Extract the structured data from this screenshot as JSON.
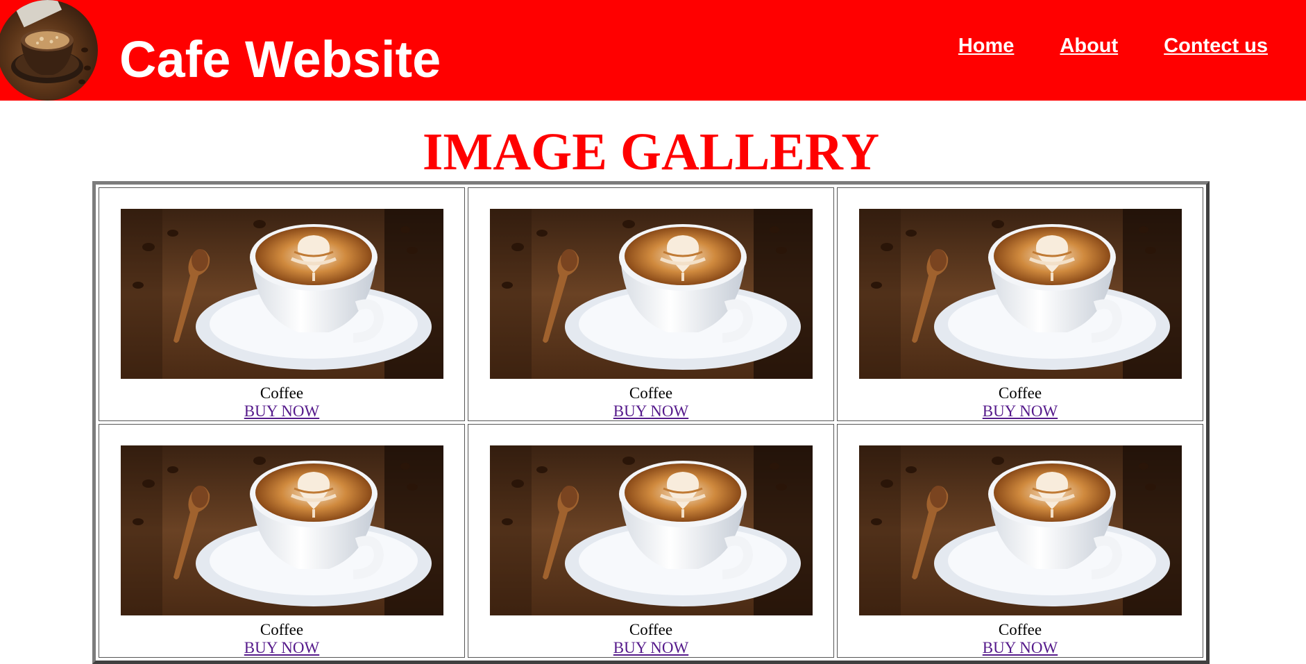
{
  "header": {
    "title": "Cafe Website",
    "logo_icon": "coffee-cup-icon",
    "background": "#ff0000",
    "nav": [
      {
        "label": "Home"
      },
      {
        "label": "About"
      },
      {
        "label": "Contect us"
      }
    ]
  },
  "gallery": {
    "title": "IMAGE GALLERY",
    "title_color": "#ff0000",
    "items": [
      {
        "caption": "Coffee",
        "link": "BUY NOW"
      },
      {
        "caption": "Coffee",
        "link": "BUY NOW"
      },
      {
        "caption": "Coffee",
        "link": "BUY NOW"
      },
      {
        "caption": "Coffee",
        "link": "BUY NOW"
      },
      {
        "caption": "Coffee",
        "link": "BUY NOW"
      },
      {
        "caption": "Coffee",
        "link": "BUY NOW"
      }
    ]
  }
}
